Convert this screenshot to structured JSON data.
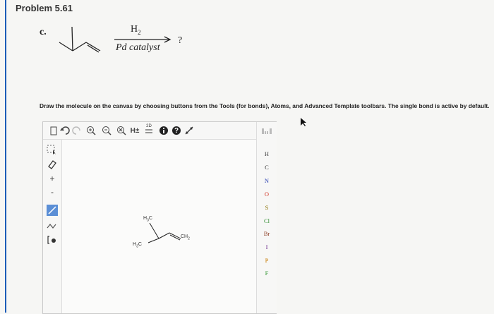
{
  "problem": {
    "title": "Problem 5.61",
    "part": "c."
  },
  "reaction": {
    "reagent_top": "H",
    "reagent_top_sub": "2",
    "reagent_bottom": "Pd catalyst",
    "product": "?"
  },
  "instruction": "Draw the molecule on the canvas by choosing buttons from the Tools (for bonds), Atoms, and Advanced Template toolbars. The single bond is active by default.",
  "toolbar": {
    "hs_label": "H±",
    "label_2d": "2D",
    "help_label": "?"
  },
  "atoms": [
    "H",
    "C",
    "N",
    "O",
    "S",
    "Cl",
    "Br",
    "I",
    "P",
    "F"
  ],
  "molecule_labels": {
    "h3c_top": "H",
    "h3c_top_sub": "3",
    "h3c_top_c": "C",
    "ch2": "CH",
    "ch2_sub": "2",
    "h3c_bottom": "H",
    "h3c_bottom_sub": "3",
    "h3c_bottom_c": "C"
  },
  "colors": {
    "accent_line": "#1c5cb8",
    "selected_tool": "#5b8fd6"
  }
}
